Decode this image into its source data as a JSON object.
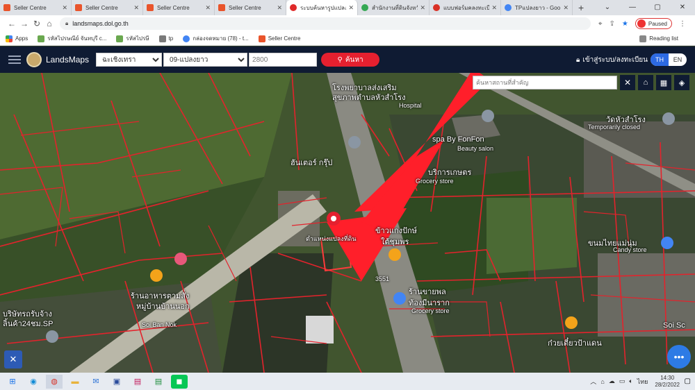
{
  "browser": {
    "tabs": [
      {
        "title": "Seller Centre",
        "color": "#e9542b"
      },
      {
        "title": "Seller Centre",
        "color": "#e9542b"
      },
      {
        "title": "Seller Centre",
        "color": "#e9542b"
      },
      {
        "title": "Seller Centre",
        "color": "#e9542b"
      },
      {
        "title": "ระบบค้นหารูปแปลงที่ดิน",
        "color": "#e02a2a"
      },
      {
        "title": "สำนักงานที่ดินจังหวัด",
        "color": "#34a853"
      },
      {
        "title": "แบบฟอร์มคลงทะเบียน",
        "color": "#d93025"
      },
      {
        "title": "TPแปลงยาว - Goo",
        "color": "#4285f4"
      }
    ],
    "new_tab": "+",
    "url": "landsmaps.dol.go.th",
    "paused": "Paused",
    "bookmarks": [
      "Apps",
      "รหัสไปรษณีย์ จันทบุรี c...",
      "รหัสไปรษี",
      "tp",
      "กล่องจดหมาย (78) - t...",
      "Seller Centre"
    ],
    "reading_list": "Reading list"
  },
  "app": {
    "logo_text": "LandsMaps",
    "province": "ฉะเชิงเทรา",
    "district": "09-แปลงยาว",
    "parcel_number": "2800",
    "search_label": "ค้นหา",
    "login_label": "เข้าสู่ระบบ/ลงทะเบียน",
    "lang_th": "TH",
    "lang_en": "EN"
  },
  "map": {
    "place_search_placeholder": "ค้นหาสถานที่สำคัญ",
    "labels": [
      {
        "text": "โรงพยาบาลส่งเสริม",
        "cls": ""
      },
      {
        "text": "สุขภาพตำบลหัวสำโรง",
        "cls": ""
      },
      {
        "text": "Hospital",
        "cls": "sm"
      },
      {
        "text": "วัดหัวสำโรง",
        "cls": ""
      },
      {
        "text": "Temporarily closed",
        "cls": "sm"
      },
      {
        "text": "spa By FonFon",
        "cls": ""
      },
      {
        "text": "Beauty salon",
        "cls": "sm"
      },
      {
        "text": "ฮันเตอร์ กรุ๊ป",
        "cls": ""
      },
      {
        "text": "บริการเกษตร",
        "cls": ""
      },
      {
        "text": "Grocery store",
        "cls": "sm"
      },
      {
        "text": "ตำแหน่งแปลงที่ดิน",
        "cls": "sm"
      },
      {
        "text": "ข้าวแกงปักษ์",
        "cls": ""
      },
      {
        "text": "ใต้ชุมพร",
        "cls": ""
      },
      {
        "text": "ขนมไทยแม่นุ่ม",
        "cls": ""
      },
      {
        "text": "Candy store",
        "cls": "sm"
      },
      {
        "text": "3551",
        "cls": "sm"
      },
      {
        "text": "ร้านขายพล",
        "cls": ""
      },
      {
        "text": "ท้องมีนาราก",
        "cls": ""
      },
      {
        "text": "Grocery store",
        "cls": "sm"
      },
      {
        "text": "ร้านอาหารตามสั่ง",
        "cls": ""
      },
      {
        "text": "หมู่บ้านบ้านนอก",
        "cls": ""
      },
      {
        "text": "บริษัทรถรับจ้าง",
        "cls": ""
      },
      {
        "text": "ลิ้นค้า24ชม.SP",
        "cls": ""
      },
      {
        "text": "Soi Ban Nok",
        "cls": "sm"
      },
      {
        "text": "ก๋วยเตี๋ยวป้าแดน",
        "cls": ""
      },
      {
        "text": "Soi Sc",
        "cls": ""
      }
    ]
  },
  "taskbar": {
    "lang": "ไทย",
    "time": "14:30",
    "date": "28/2/2022"
  },
  "colors": {
    "app_bar": "#0f1b33",
    "search_button": "#e5202f",
    "parcel_lines": "#e3232c",
    "lang_active": "#2d6ae3"
  }
}
